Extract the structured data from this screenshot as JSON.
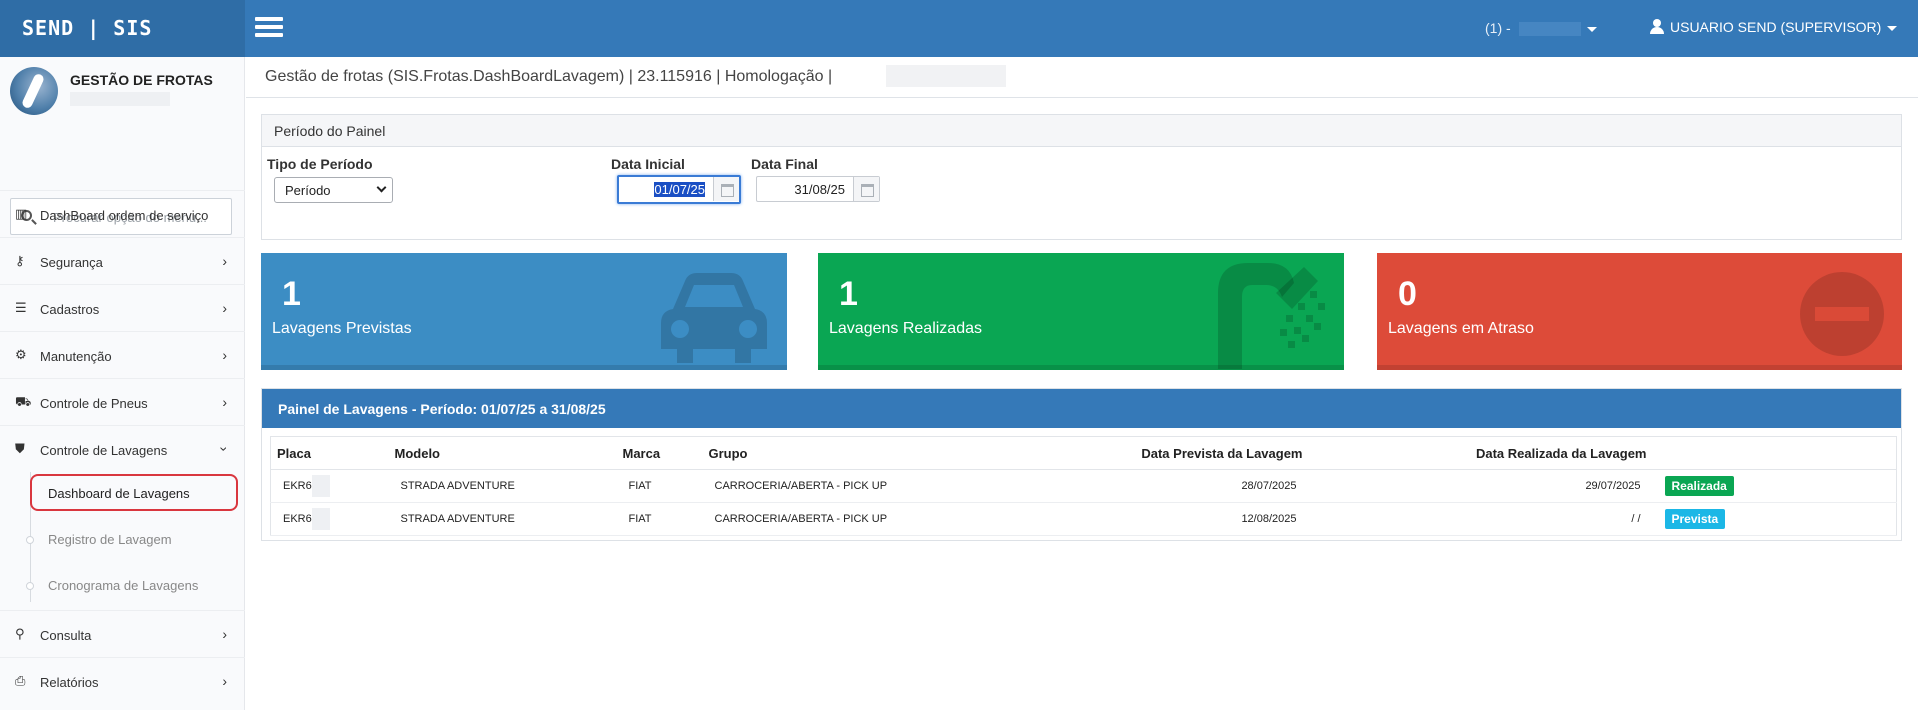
{
  "topbar": {
    "brand": "SEND | SIS",
    "company": "(1) -",
    "user": "USUARIO SEND (SUPERVISOR)"
  },
  "sidebar": {
    "title": "GESTÃO DE FROTAS",
    "search_placeholder": "Procurar opção do menu...",
    "items": [
      {
        "label": "DashBoard ordem de serviço",
        "icon": "bar-chart-icon"
      },
      {
        "label": "Segurança",
        "icon": "key-icon"
      },
      {
        "label": "Cadastros",
        "icon": "list-icon"
      },
      {
        "label": "Manutenção",
        "icon": "cogs-icon"
      },
      {
        "label": "Controle de Pneus",
        "icon": "truck-icon"
      },
      {
        "label": "Controle de Lavagens",
        "icon": "shower-icon"
      }
    ],
    "subitems": [
      {
        "label": "Dashboard de Lavagens"
      },
      {
        "label": "Registro de Lavagem"
      },
      {
        "label": "Cronograma de Lavagens"
      }
    ],
    "bottom_items": [
      {
        "label": "Consulta",
        "icon": "search-icon"
      },
      {
        "label": "Relatórios",
        "icon": "print-icon"
      }
    ]
  },
  "page_header": "Gestão de frotas (SIS.Frotas.DashBoardLavagem) | 23.115916 | Homologação |",
  "periodo": {
    "title": "Período do Painel",
    "tipo_label": "Tipo de Período",
    "tipo_value": "Período",
    "inicial_label": "Data Inicial",
    "inicial_value": "01/07/25",
    "final_label": "Data Final",
    "final_value": "31/08/25"
  },
  "stats": [
    {
      "value": "1",
      "label": "Lavagens Previstas",
      "color": "#3c8dc4",
      "icon": "car-icon"
    },
    {
      "value": "1",
      "label": "Lavagens Realizadas",
      "color": "#0aa653",
      "icon": "shower-icon"
    },
    {
      "value": "0",
      "label": "Lavagens em Atraso",
      "color": "#dd4b39",
      "icon": "minus-circle-icon"
    }
  ],
  "lavagens": {
    "title": "Painel de Lavagens - Período: 01/07/25 a 31/08/25",
    "headers": [
      "Placa",
      "Modelo",
      "Marca",
      "Grupo",
      "Data Prevista da Lavagem",
      "Data Realizada da Lavagem",
      ""
    ],
    "rows": [
      {
        "placa": "EKR6",
        "modelo": "STRADA ADVENTURE",
        "marca": "FIAT",
        "grupo": "CARROCERIA/ABERTA - PICK UP",
        "prevista": "28/07/2025",
        "realizada": "29/07/2025",
        "status": "Realizada",
        "status_color": "#0aa653"
      },
      {
        "placa": "EKR6",
        "modelo": "STRADA ADVENTURE",
        "marca": "FIAT",
        "grupo": "CARROCERIA/ABERTA - PICK UP",
        "prevista": "12/08/2025",
        "realizada": "/ /",
        "status": "Prevista",
        "status_color": "#1bb7e6"
      }
    ]
  }
}
